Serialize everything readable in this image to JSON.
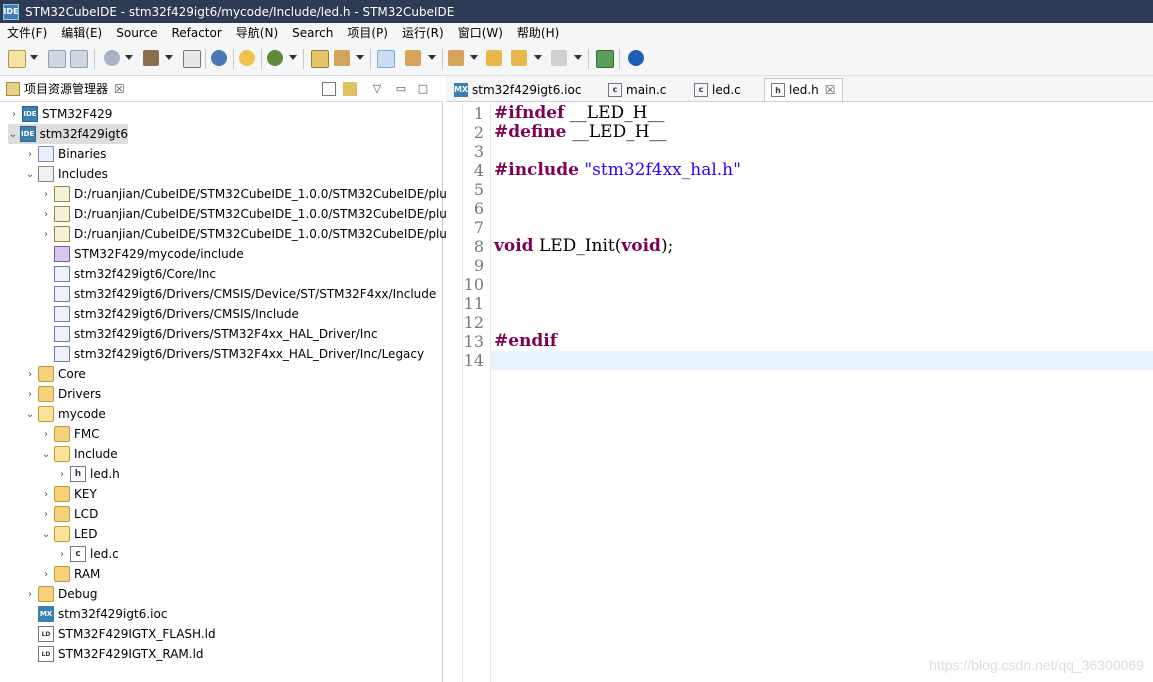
{
  "window": {
    "title": "STM32CubeIDE - stm32f429igt6/mycode/Include/led.h - STM32CubeIDE",
    "app_icon": "IDE"
  },
  "menu": [
    "文件(F)",
    "编辑(E)",
    "Source",
    "Refactor",
    "导航(N)",
    "Search",
    "项目(P)",
    "运行(R)",
    "窗口(W)",
    "帮助(H)"
  ],
  "explorer": {
    "title": "项目资源管理器",
    "close": "☒",
    "items": [
      {
        "label": "STM32F429",
        "icon": "project-icon",
        "badge": "IDE"
      },
      {
        "label": "stm32f429igt6",
        "icon": "project-icon",
        "badge": "IDE"
      },
      {
        "label": "Binaries",
        "icon": "binaries-icon"
      },
      {
        "label": "Includes",
        "icon": "includes-icon"
      },
      {
        "label": "D:/ruanjian/CubeIDE/STM32CubeIDE_1.0.0/STM32CubeIDE/plu",
        "icon": "include-path-icon"
      },
      {
        "label": "D:/ruanjian/CubeIDE/STM32CubeIDE_1.0.0/STM32CubeIDE/plu",
        "icon": "include-path-icon"
      },
      {
        "label": "D:/ruanjian/CubeIDE/STM32CubeIDE_1.0.0/STM32CubeIDE/plu",
        "icon": "include-path-icon"
      },
      {
        "label": "STM32F429/mycode/include",
        "icon": "project-include-icon"
      },
      {
        "label": "stm32f429igt6/Core/Inc",
        "icon": "include-dir-icon"
      },
      {
        "label": "stm32f429igt6/Drivers/CMSIS/Device/ST/STM32F4xx/Include",
        "icon": "include-dir-icon"
      },
      {
        "label": "stm32f429igt6/Drivers/CMSIS/Include",
        "icon": "include-dir-icon"
      },
      {
        "label": "stm32f429igt6/Drivers/STM32F4xx_HAL_Driver/Inc",
        "icon": "include-dir-icon"
      },
      {
        "label": "stm32f429igt6/Drivers/STM32F4xx_HAL_Driver/Inc/Legacy",
        "icon": "include-dir-icon"
      },
      {
        "label": "Core",
        "icon": "folder-icon"
      },
      {
        "label": "Drivers",
        "icon": "folder-icon"
      },
      {
        "label": "mycode",
        "icon": "folder-open-icon"
      },
      {
        "label": "FMC",
        "icon": "folder-icon"
      },
      {
        "label": "Include",
        "icon": "folder-open-icon"
      },
      {
        "label": "led.h",
        "icon": "header-file-icon",
        "badge": "h"
      },
      {
        "label": "KEY",
        "icon": "folder-icon"
      },
      {
        "label": "LCD",
        "icon": "folder-icon"
      },
      {
        "label": "LED",
        "icon": "folder-open-icon"
      },
      {
        "label": "led.c",
        "icon": "c-file-icon",
        "badge": "c"
      },
      {
        "label": "RAM",
        "icon": "folder-icon"
      },
      {
        "label": "Debug",
        "icon": "folder-icon"
      },
      {
        "label": "stm32f429igt6.ioc",
        "icon": "mx-file-icon",
        "badge": "MX"
      },
      {
        "label": "STM32F429IGTX_FLASH.ld",
        "icon": "ld-file-icon",
        "badge": "LD"
      },
      {
        "label": "STM32F429IGTX_RAM.ld",
        "icon": "ld-file-icon",
        "badge": "LD"
      }
    ],
    "selected": "stm32f429igt6"
  },
  "tabs": [
    {
      "label": "stm32f429igt6.ioc",
      "icon": "mx-file-icon",
      "badge": "MX"
    },
    {
      "label": "main.c",
      "icon": "c-file-icon",
      "badge": "c"
    },
    {
      "label": "led.c",
      "icon": "c-file-icon",
      "badge": "c"
    },
    {
      "label": "led.h",
      "icon": "header-file-icon",
      "badge": "h",
      "active": true,
      "close": "☒"
    }
  ],
  "code": {
    "line_numbers": [
      "1",
      "2",
      "3",
      "4",
      "5",
      "6",
      "7",
      "8",
      "9",
      "10",
      "11",
      "12",
      "13",
      "14"
    ],
    "lines": {
      "l1_kw": "#ifndef",
      "l1_rest": " __LED_H__",
      "l2_kw": "#define",
      "l2_rest": " __LED_H__",
      "l4_kw": "#include",
      "l4_str": " \"stm32f4xx_hal.h\"",
      "l8_kw1": "void",
      "l8_mid": " LED_Init(",
      "l8_kw2": "void",
      "l8_end": ");",
      "l13_kw": "#endif"
    }
  },
  "watermark": "https://blog.csdn.net/qq_36300069",
  "colors": {
    "keyword": "#7f0055",
    "string": "#2a00ff",
    "titlebar": "#2d3b55",
    "current_line": "#e8f2fe"
  }
}
